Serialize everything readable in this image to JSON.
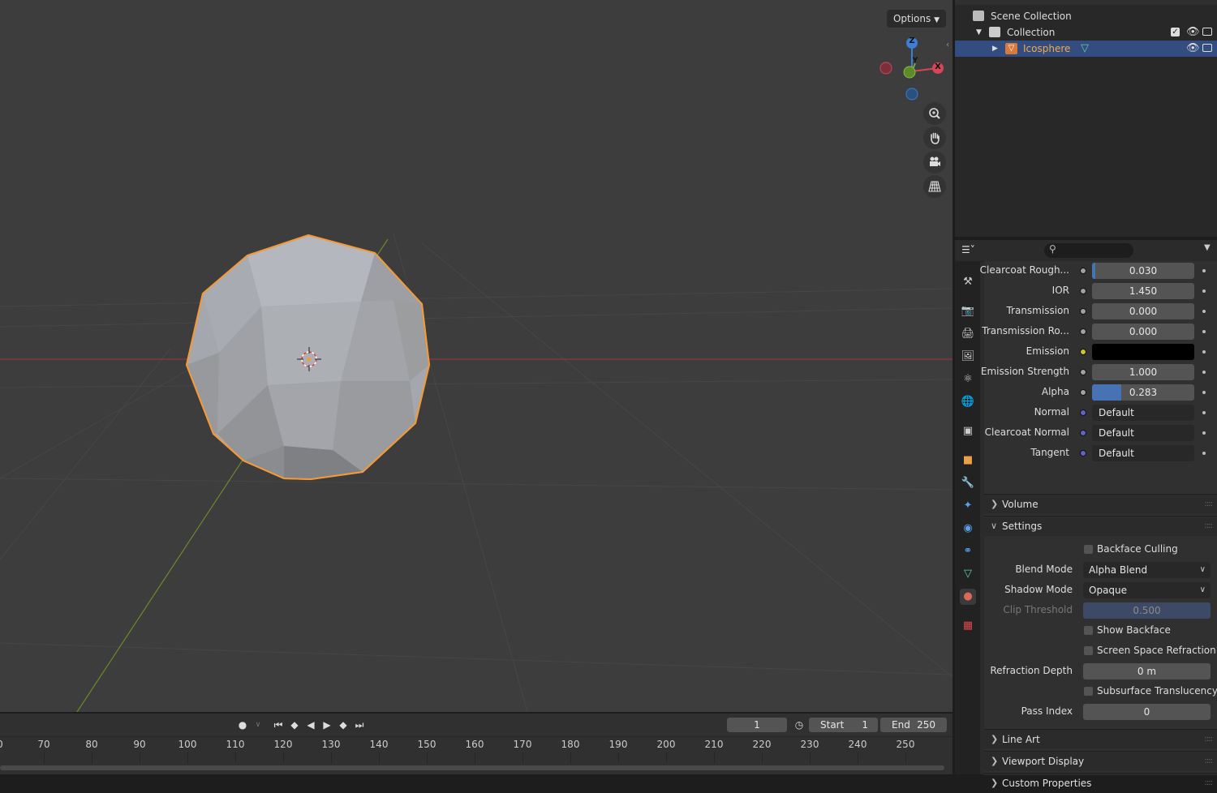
{
  "viewport": {
    "options_label": "Options",
    "gizmo": {
      "z": "Z",
      "x": "X",
      "y": "Y"
    },
    "nav_icons": [
      "zoom-icon",
      "pan-hand-icon",
      "camera-icon",
      "grid-view-icon"
    ],
    "selection_color": "#f29a3a"
  },
  "outliner": {
    "scene_collection": "Scene Collection",
    "collection": "Collection",
    "object": "Icosphere",
    "object_color": "#e8a04a",
    "selected_row_color": "#334d80"
  },
  "properties": {
    "rows": [
      {
        "label": "Clearcoat Rough...",
        "value": "0.030",
        "fraction": 0.03,
        "socket": "#a1a1a1"
      },
      {
        "label": "IOR",
        "value": "1.450",
        "fraction": 0,
        "socket": "#a1a1a1"
      },
      {
        "label": "Transmission",
        "value": "0.000",
        "fraction": 0,
        "socket": "#a1a1a1"
      },
      {
        "label": "Transmission Ro...",
        "value": "0.000",
        "fraction": 0,
        "socket": "#a1a1a1"
      },
      {
        "label": "Emission",
        "value": "",
        "fraction": 0,
        "socket": "#c7c729",
        "color_swatch": "#000000"
      },
      {
        "label": "Emission Strength",
        "value": "1.000",
        "fraction": 0,
        "socket": "#a1a1a1"
      },
      {
        "label": "Alpha",
        "value": "0.283",
        "fraction": 0.283,
        "socket": "#a1a1a1"
      },
      {
        "label": "Normal",
        "value": "Default",
        "socket": "#6363c7",
        "vector": true
      },
      {
        "label": "Clearcoat Normal",
        "value": "Default",
        "socket": "#6363c7",
        "vector": true
      },
      {
        "label": "Tangent",
        "value": "Default",
        "socket": "#6363c7",
        "vector": true
      }
    ],
    "panels": {
      "volume": "Volume",
      "settings": "Settings",
      "line_art": "Line Art",
      "viewport_display": "Viewport Display",
      "custom_properties": "Custom Properties"
    },
    "settings": {
      "backface_culling": "Backface Culling",
      "blend_mode_label": "Blend Mode",
      "blend_mode_value": "Alpha Blend",
      "shadow_mode_label": "Shadow Mode",
      "shadow_mode_value": "Opaque",
      "clip_threshold_label": "Clip Threshold",
      "clip_threshold_value": "0.500",
      "show_backface": "Show Backface",
      "screen_space_refraction": "Screen Space Refraction",
      "refraction_depth_label": "Refraction Depth",
      "refraction_depth_value": "0 m",
      "subsurface_translucency": "Subsurface Translucency",
      "pass_index_label": "Pass Index",
      "pass_index_value": "0"
    },
    "tab_icons": [
      "tool-icon",
      "render-icon",
      "output-icon",
      "view-layer-icon",
      "scene-icon",
      "world-icon",
      "collection-icon",
      "object-icon",
      "modifier-icon",
      "particles-icon",
      "physics-icon",
      "constraints-icon",
      "data-icon",
      "material-icon",
      "texture-icon"
    ]
  },
  "timeline": {
    "current_frame": "1",
    "start_label": "Start",
    "start_value": "1",
    "end_label": "End",
    "end_value": "250",
    "ticks": [
      "70",
      "80",
      "90",
      "100",
      "110",
      "120",
      "130",
      "140",
      "150",
      "160",
      "170",
      "180",
      "190",
      "200",
      "210",
      "220",
      "230",
      "240",
      "250"
    ]
  }
}
